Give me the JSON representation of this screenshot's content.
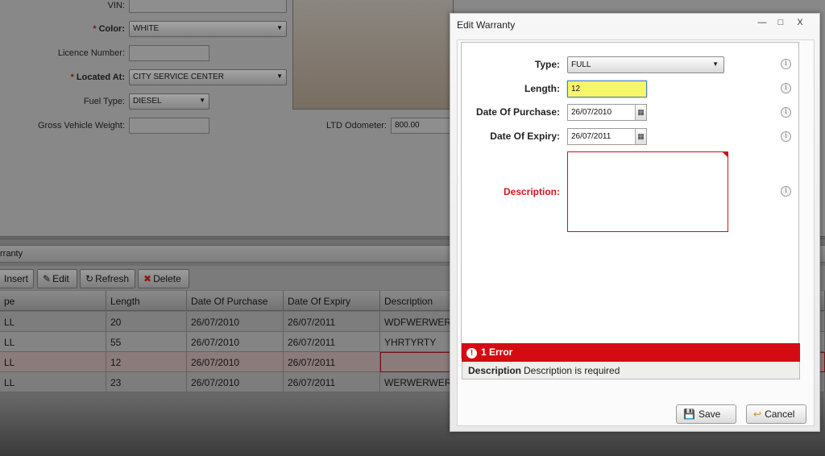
{
  "background": {
    "form": {
      "vin_label": "VIN:",
      "color_label": "Color:",
      "color_value": "WHITE",
      "licence_label": "Licence Number:",
      "located_label": "Located At:",
      "located_value": "CITY SERVICE CENTER",
      "fuel_label": "Fuel Type:",
      "fuel_value": "DIESEL",
      "gvw_label": "Gross Vehicle Weight:",
      "ltd_label": "LTD Odometer:",
      "ltd_value": "800.00",
      "required_mark": "*"
    },
    "panel_title": "rranty",
    "toolbar": {
      "insert": "Insert",
      "edit": "Edit",
      "refresh": "Refresh",
      "delete": "Delete"
    },
    "grid": {
      "columns": [
        "pe",
        "Length",
        "Date Of Purchase",
        "Date Of Expiry",
        "Description"
      ],
      "rows": [
        [
          "LL",
          "20",
          "26/07/2010",
          "26/07/2011",
          "WDFWERWER"
        ],
        [
          "LL",
          "55",
          "26/07/2010",
          "26/07/2011",
          "YHRTYRTY"
        ],
        [
          "LL",
          "12",
          "26/07/2010",
          "26/07/2011",
          ""
        ],
        [
          "LL",
          "23",
          "26/07/2010",
          "26/07/2011",
          "WERWERWER"
        ]
      ]
    }
  },
  "dialog": {
    "title": "Edit Warranty",
    "window_buttons": {
      "minimize": "—",
      "maximize": "□",
      "close": "X"
    },
    "fields": {
      "type_label": "Type:",
      "type_value": "FULL",
      "length_label": "Length:",
      "length_value": "12",
      "purchase_label": "Date Of Purchase:",
      "purchase_value": "26/07/2010",
      "expiry_label": "Date Of Expiry:",
      "expiry_value": "26/07/2011",
      "description_label": "Description:"
    },
    "error": {
      "summary": "1 Error",
      "field": "Description",
      "message": "Description is required"
    },
    "buttons": {
      "save": "Save",
      "cancel": "Cancel"
    }
  },
  "icons": {
    "info": "info-icon",
    "calendar": "calendar-icon",
    "dropdown": "chevron-down-icon",
    "error": "error-icon",
    "save": "save-icon",
    "cancel": "cancel-icon"
  },
  "colors": {
    "error_red": "#d60a12",
    "focus_yellow": "#f6f66a"
  }
}
